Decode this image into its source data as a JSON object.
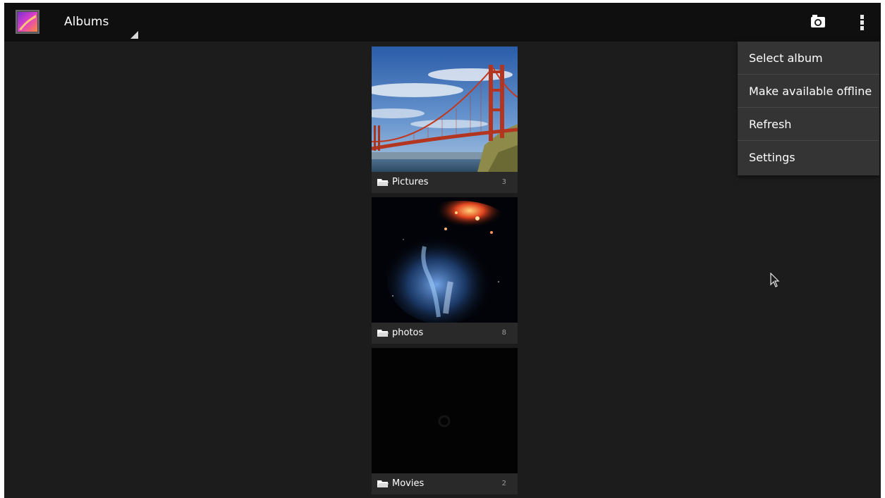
{
  "action_bar": {
    "title": "Albums",
    "app_icon": "gallery-icon",
    "camera_icon": "camera-icon",
    "overflow_icon": "overflow-menu-icon"
  },
  "albums": [
    {
      "name": "Pictures",
      "count": "3",
      "thumbnail": "golden-gate-bridge-photo"
    },
    {
      "name": "photos",
      "count": "8",
      "thumbnail": "nebula-hand-photo"
    },
    {
      "name": "Movies",
      "count": "2",
      "thumbnail": "dark-video-frame"
    }
  ],
  "menu": {
    "items": [
      "Select album",
      "Make available offline",
      "Refresh",
      "Settings"
    ]
  },
  "colors": {
    "background": "#1c1c1c",
    "action_bar": "#0f0f0f",
    "menu_background": "#343434",
    "label_bar": "#2d2d2d"
  }
}
